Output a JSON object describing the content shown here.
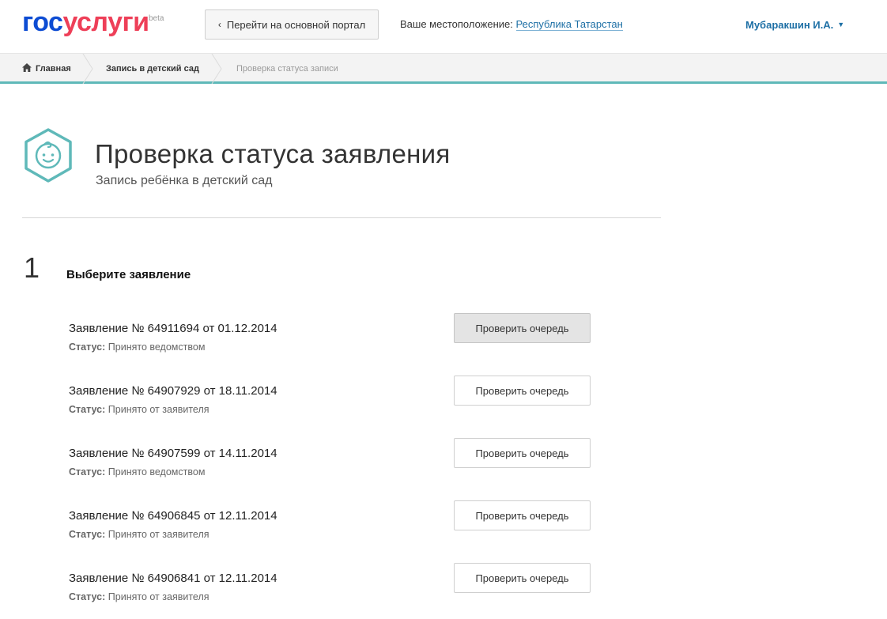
{
  "header": {
    "logo_part1": "гос",
    "logo_part2": "услуги",
    "logo_beta": "beta",
    "portal_button": "Перейти на основной портал",
    "location_label": "Ваше местоположение:",
    "location_value": "Республика Татарстан",
    "user_name": "Мубаракшин И.А."
  },
  "breadcrumb": {
    "home": "Главная",
    "section": "Запись в детский сад",
    "current": "Проверка статуса записи"
  },
  "page": {
    "title": "Проверка статуса заявления",
    "subtitle": "Запись ребёнка в детский сад"
  },
  "step": {
    "number": "1",
    "label": "Выберите заявление"
  },
  "status_label": "Статус:",
  "applications": [
    {
      "title": "Заявление № 64911694 от 01.12.2014",
      "status": "Принято ведомством",
      "button": "Проверить очередь",
      "active": true
    },
    {
      "title": "Заявление № 64907929 от 18.11.2014",
      "status": "Принято от заявителя",
      "button": "Проверить очередь",
      "active": false
    },
    {
      "title": "Заявление № 64907599 от 14.11.2014",
      "status": "Принято ведомством",
      "button": "Проверить очередь",
      "active": false
    },
    {
      "title": "Заявление № 64906845 от 12.11.2014",
      "status": "Принято от заявителя",
      "button": "Проверить очередь",
      "active": false
    },
    {
      "title": "Заявление № 64906841 от 12.11.2014",
      "status": "Принято от заявителя",
      "button": "Проверить очередь",
      "active": false
    }
  ],
  "colors": {
    "brand_blue": "#0d4cd3",
    "brand_red": "#ee3f58",
    "link_blue": "#1d6fa5",
    "accent_teal": "#5fb9b9"
  },
  "icons": {
    "back": "chevron-left-icon",
    "user_menu": "caret-down-icon",
    "home": "house-icon",
    "service": "baby-face-icon"
  }
}
